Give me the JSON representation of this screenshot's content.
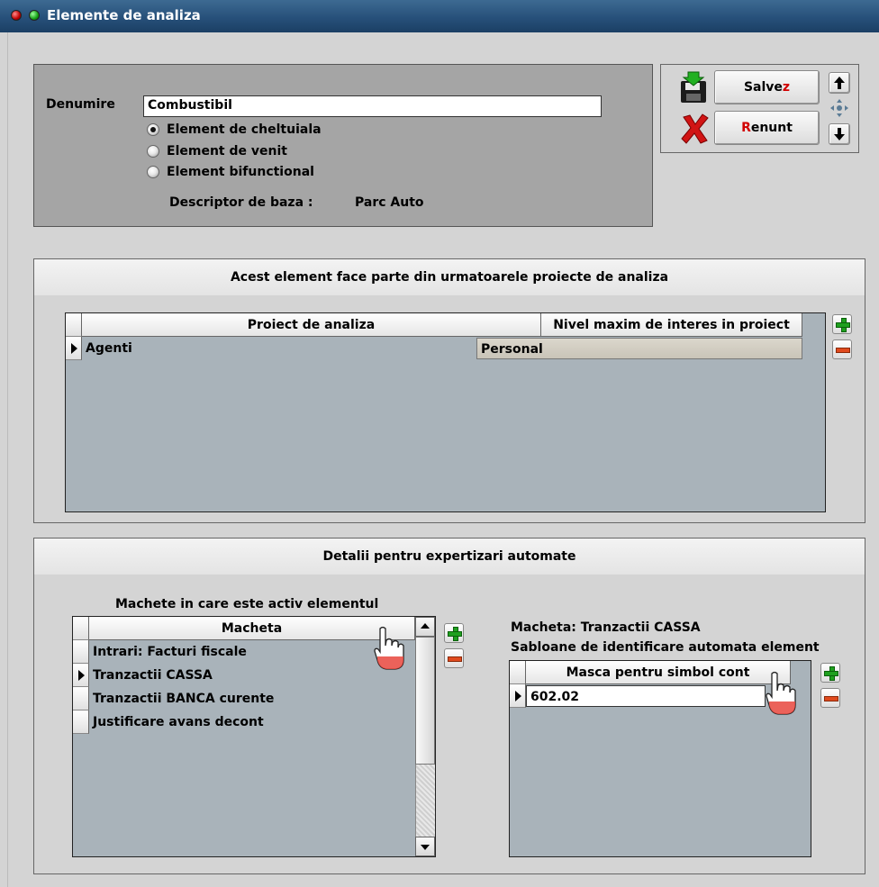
{
  "window": {
    "title": "Elemente de analiza"
  },
  "form": {
    "denumire_label": "Denumire",
    "denumire_value": "Combustibil",
    "radios": [
      {
        "label": "Element de cheltuiala",
        "checked": true
      },
      {
        "label": "Element de venit",
        "checked": false
      },
      {
        "label": "Element bifunctional",
        "checked": false
      }
    ],
    "descriptor_label": "Descriptor de baza :",
    "descriptor_value": "Parc Auto"
  },
  "buttons": {
    "save_prefix": "Salve",
    "save_hotkey": "z",
    "cancel_hotkey": "R",
    "cancel_suffix": "enunt"
  },
  "projects": {
    "title": "Acest element face parte din urmatoarele proiecte de analiza",
    "columns": [
      "Proiect de analiza",
      "Nivel maxim de interes in proiect"
    ],
    "rows": [
      {
        "proiect": "Agenti",
        "nivel": "Personal"
      }
    ]
  },
  "details": {
    "title": "Detalii pentru expertizari automate",
    "macheta_caption": "Machete in care este activ elementul",
    "macheta_column": "Macheta",
    "macheta_rows": [
      "Intrari: Facturi fiscale",
      "Tranzactii CASSA",
      "Tranzactii BANCA curente",
      "Justificare avans decont"
    ],
    "macheta_current_index": 1,
    "macheta_info": "Macheta:  Tranzactii CASSA",
    "sabloane_caption": "Sabloane de identificare automata element",
    "masca_column": "Masca pentru simbol cont",
    "masca_rows": [
      "602.02"
    ]
  },
  "colors": {
    "title_bar": "#27507a",
    "grid_bg": "#a9b3ba",
    "panel_bg": "#a5a5a5",
    "hotkey": "#d10000"
  }
}
